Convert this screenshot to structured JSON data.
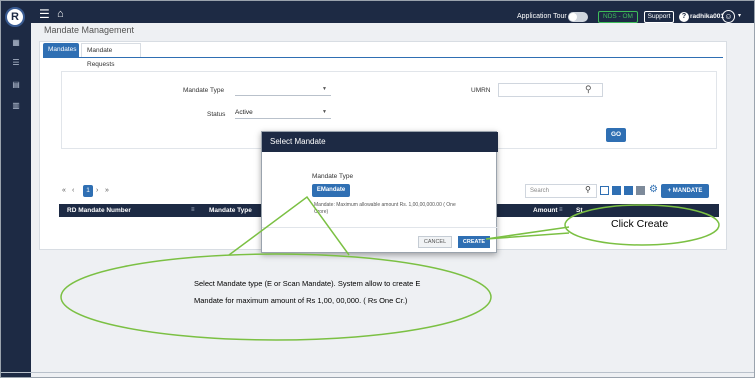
{
  "topbar": {
    "logo_text": "R",
    "menu_icon": "menu-icon",
    "home_icon": "home-icon",
    "application_tour_label": "Application Tour",
    "env_badge": "NDS - OM",
    "support_label": "Support",
    "username": "radhika001",
    "help_icon": "help-icon",
    "avatar_icon": "user-circle-icon"
  },
  "sidebar": {
    "icons": [
      "grid-icon",
      "list-icon",
      "chart-icon",
      "document-icon"
    ]
  },
  "page": {
    "title": "Mandate Management",
    "tabs": [
      {
        "label": "Mandates",
        "active": true
      },
      {
        "label": "Mandate Requests",
        "active": false
      }
    ]
  },
  "filters": {
    "mandate_type_label": "Mandate Type",
    "mandate_type_value": "",
    "status_label": "Status",
    "status_value": "Active",
    "umrn_label": "UMRN",
    "go_label": "GO"
  },
  "table_controls": {
    "pager_first": "«",
    "pager_prev": "‹",
    "current_page": "1",
    "pager_next": "›",
    "pager_last": "»",
    "search_placeholder": "Search",
    "add_mandate_label": "+ MANDATE"
  },
  "table": {
    "columns": [
      "RD Mandate Number",
      "Mandate Type",
      "Amount",
      "St"
    ]
  },
  "modal": {
    "title": "Select Mandate",
    "mandate_type_label": "Mandate Type",
    "emandate_label": "EMandate",
    "note": "Mandate: Maximum allowable amount Rs. 1,00,00,000.00 ( One Crore)",
    "cancel_label": "CANCEL",
    "create_label": "CREATE"
  },
  "annotations": {
    "callout_select": "Select Mandate type (E or Scan Mandate). System allow to create E Mandate for maximum amount of Rs 1,00, 00,000. ( Rs One Cr.)",
    "callout_create": "Click Create"
  },
  "colors": {
    "navy": "#1d2a44",
    "accent": "#2f6fb3",
    "env_green": "#3fbf5a",
    "callout_line": "#7bc043"
  }
}
